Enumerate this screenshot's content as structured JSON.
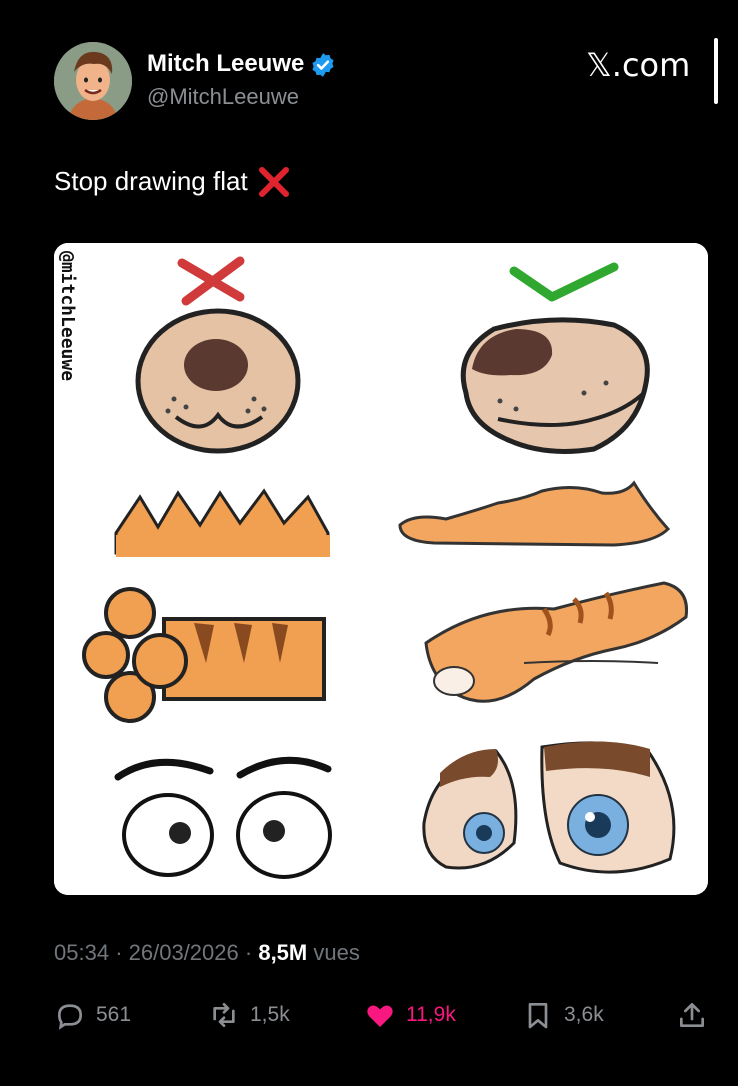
{
  "author": {
    "name": "Mitch Leeuwe",
    "handle": "@MitchLeeuwe",
    "verified": true
  },
  "brand": "𝕏.com",
  "tweet": {
    "text": "Stop drawing flat",
    "emoji": "cross-mark"
  },
  "image": {
    "watermark": "@mitchLeeuwe",
    "columns": [
      "wrong",
      "right"
    ],
    "rows": [
      "nose",
      "fur",
      "paw",
      "eyes"
    ]
  },
  "meta": {
    "time": "05:34",
    "date": "26/03/2026",
    "views_count": "8,5M",
    "views_label": "vues"
  },
  "actions": {
    "replies": "561",
    "reposts": "1,5k",
    "likes": "11,9k",
    "bookmarks": "3,6k"
  },
  "colors": {
    "background": "#000000",
    "like": "#f91880",
    "verified": "#1d9bf0",
    "muted": "#71767b"
  }
}
